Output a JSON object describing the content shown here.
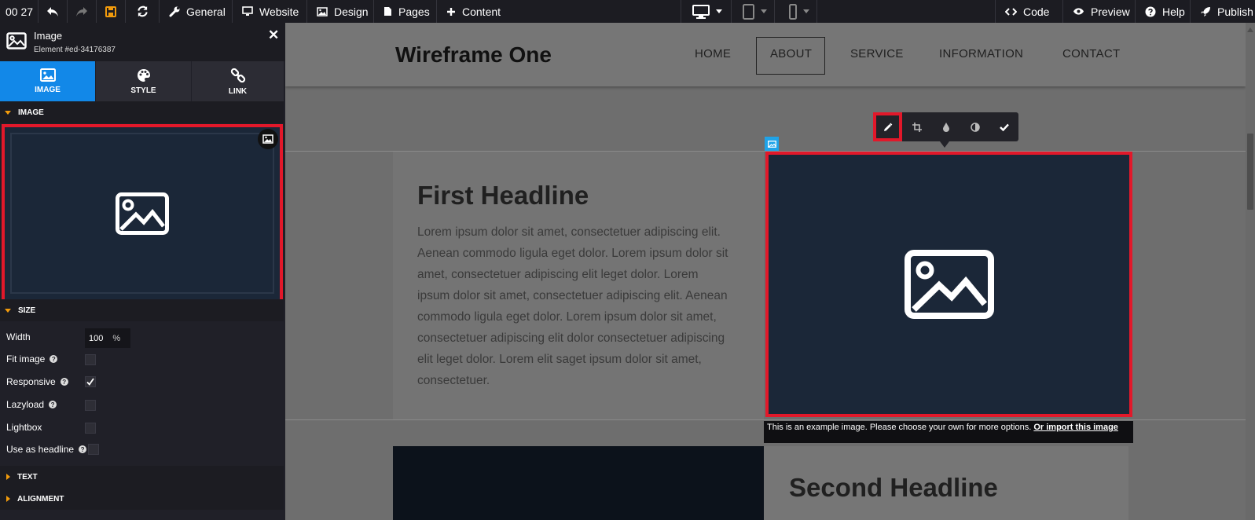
{
  "topbar": {
    "clock": "00 27",
    "general": "General",
    "website": "Website",
    "design": "Design",
    "pages": "Pages",
    "content": "Content",
    "code": "Code",
    "preview": "Preview",
    "help": "Help",
    "publish": "Publish"
  },
  "panel": {
    "title": "Image",
    "subtitle": "Element #ed-34176387",
    "tabs": [
      "IMAGE",
      "STYLE",
      "LINK"
    ],
    "sections": {
      "image": "IMAGE",
      "size": "SIZE",
      "text": "TEXT",
      "alignment": "ALIGNMENT"
    },
    "fields": {
      "width_label": "Width",
      "width_value": "100",
      "width_unit": "%",
      "fit_image": "Fit image",
      "responsive": "Responsive",
      "lazyload": "Lazyload",
      "lightbox": "Lightbox",
      "use_as_headline": "Use as headline"
    }
  },
  "site": {
    "brand": "Wireframe One",
    "nav": [
      "HOME",
      "ABOUT",
      "SERVICE",
      "INFORMATION",
      "CONTACT"
    ],
    "headline1": "First Headline",
    "paragraph": "Lorem ipsum dolor sit amet, consectetuer adipiscing elit. Aenean commodo ligula eget dolor. Lorem ipsum dolor sit amet, consectetuer adipiscing elit leget dolor. Lorem ipsum dolor sit amet, consectetuer adipiscing elit. Aenean commodo ligula eget dolor. Lorem ipsum dolor sit amet, consectetuer adipiscing elit dolor consectetuer adipiscing elit leget dolor. Lorem elit saget ipsum dolor sit amet, consectetuer.",
    "headline2": "Second Headline",
    "image_note": "This is an example image. Please choose your own for more options.",
    "image_note_link": "Or import this image"
  },
  "colors": {
    "accent_blue": "#1288e8",
    "highlight_red": "#e2182a",
    "section_orange": "#f29b0c",
    "image_bg": "#1b2738"
  }
}
